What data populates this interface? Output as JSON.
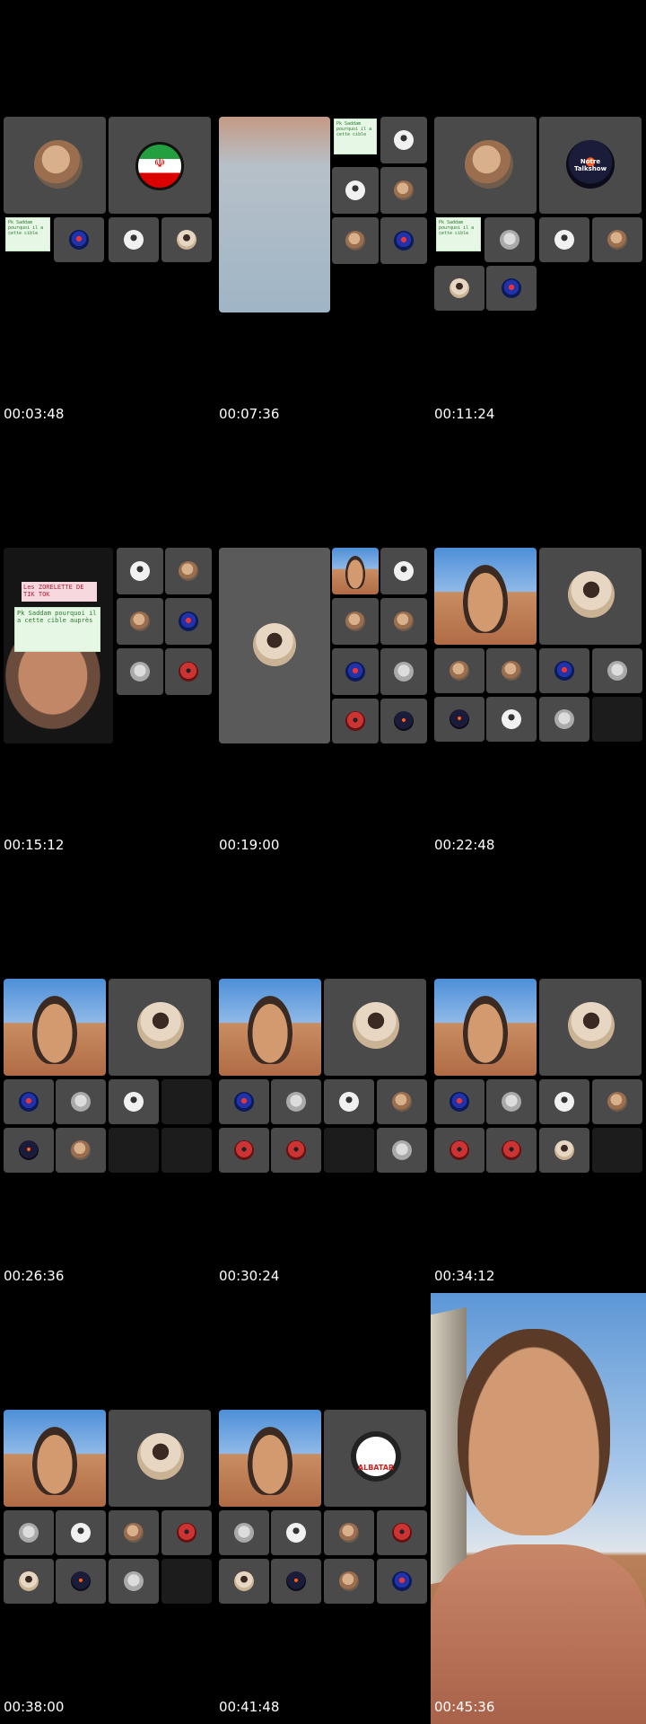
{
  "timestamps": [
    "00:03:48",
    "00:07:36",
    "00:11:24",
    "00:15:12",
    "00:19:00",
    "00:22:48",
    "00:26:36",
    "00:30:24",
    "00:34:12",
    "00:38:00",
    "00:41:48",
    "00:45:36"
  ],
  "notes": {
    "note_small": "Pk Saddam pourquoi il a cette cible",
    "tiktok_title": "Les ZORELETTE DE TIK TOK",
    "tiktok_body": "Pk Saddam pourquoi il a cette cible auprès"
  },
  "badges": {
    "talkshow": "Notre Talkshow",
    "albatar": "ALBATAR"
  },
  "colors": {
    "background": "#000000",
    "tile": "#4a4a4a",
    "timestamp": "#ffffff"
  }
}
